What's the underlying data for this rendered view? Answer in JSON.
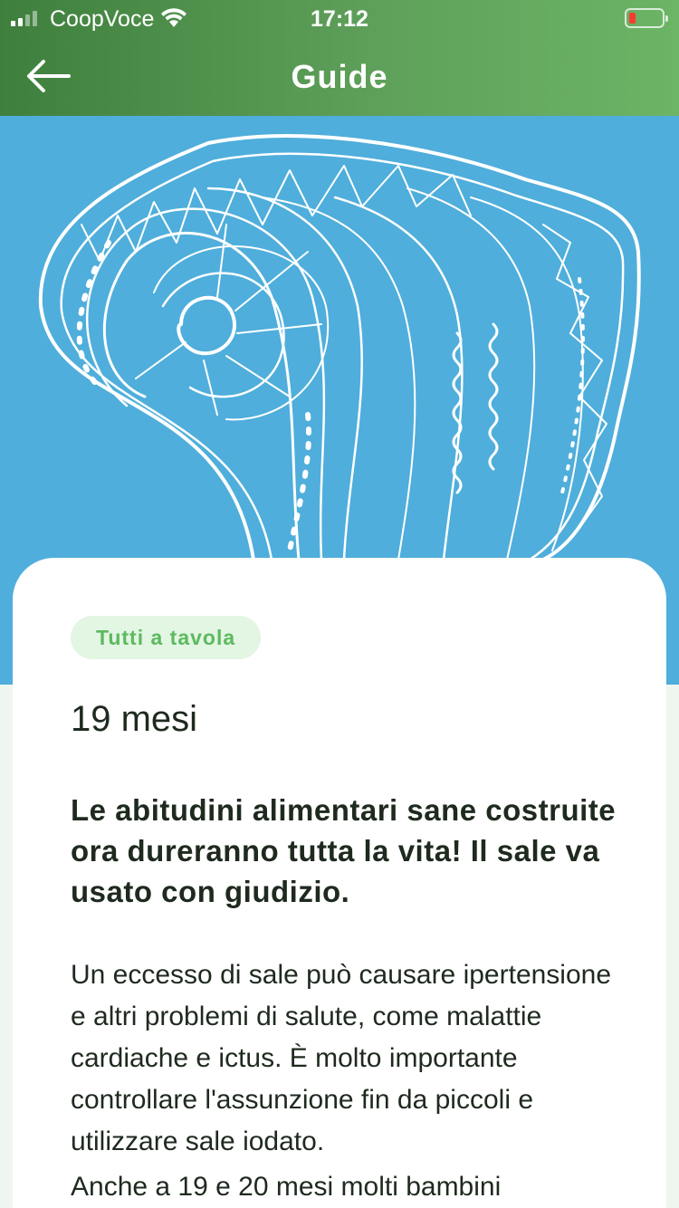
{
  "status_bar": {
    "carrier": "CoopVoce",
    "time": "17:12"
  },
  "nav": {
    "title": "Guide",
    "back_icon": "arrow-left-icon"
  },
  "hero": {
    "background": "#4faedb",
    "illustration": "spiral-shell-line-art"
  },
  "article": {
    "category": "Tutti a tavola",
    "age": "19 mesi",
    "headline": "Le abitudini alimentari sane costruite ora dureranno tutta la vita! Il sale va usato con giudizio.",
    "paragraphs": [
      "Un eccesso di sale può causare ipertensione e altri problemi di salute, come malattie cardiache e ictus. È molto importante controllare l'assunzione fin da piccoli e utilizzare sale iodato.",
      "Anche a 19 e 20 mesi molti bambini"
    ]
  },
  "colors": {
    "header_start": "#3f7f3d",
    "header_end": "#6cb466",
    "tag_bg": "#e3f5e3",
    "tag_text": "#5cba5e",
    "text": "#1f2a1f"
  }
}
